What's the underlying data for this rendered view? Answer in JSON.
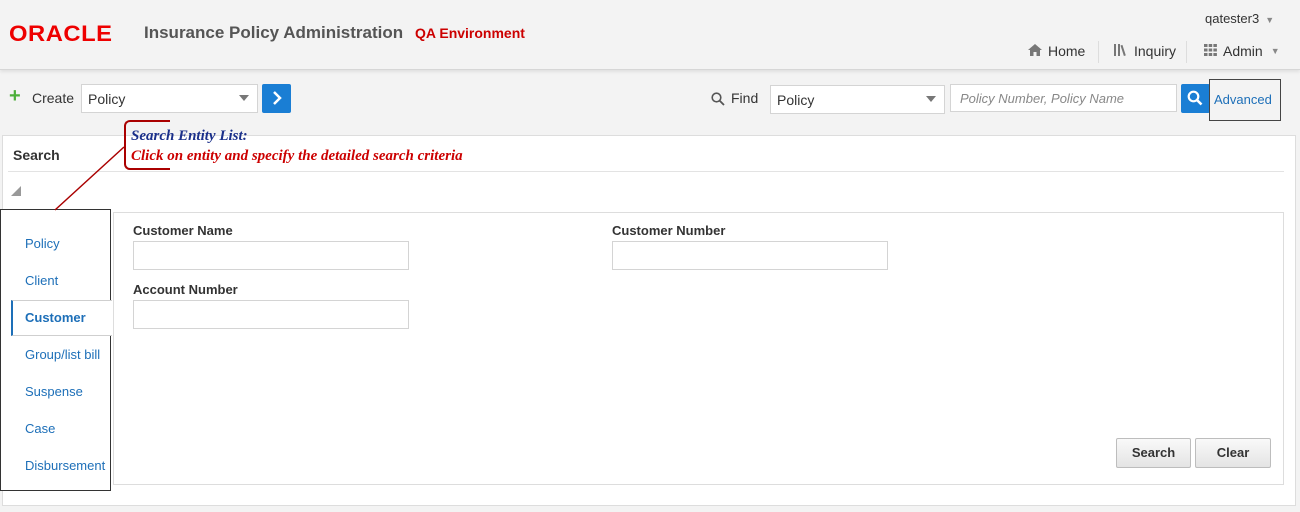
{
  "header": {
    "logo_text": "ORACLE",
    "app_title": "Insurance Policy Administration",
    "environment": "QA Environment",
    "user": "qatester3",
    "nav": [
      {
        "label": "Home",
        "icon": "home-icon"
      },
      {
        "label": "Inquiry",
        "icon": "library-icon"
      },
      {
        "label": "Admin",
        "icon": "grid-icon"
      }
    ]
  },
  "toolbar": {
    "create_label": "Create",
    "create_select": "Policy",
    "find_label": "Find",
    "find_select": "Policy",
    "find_placeholder": "Policy Number, Policy Name",
    "advanced_label": "Advanced"
  },
  "search": {
    "title": "Search",
    "entities": [
      "Policy",
      "Client",
      "Customer",
      "Group/list bill",
      "Suspense",
      "Case",
      "Disbursement"
    ],
    "active_entity": "Customer",
    "fields": {
      "customer_name_label": "Customer Name",
      "customer_number_label": "Customer Number",
      "account_number_label": "Account Number"
    },
    "search_button": "Search",
    "clear_button": "Clear"
  },
  "callout": {
    "title": "Search Entity List:",
    "text": "Click on entity and specify the detailed search criteria",
    "color_title": "#1a2f8a",
    "color_text": "#cc0000"
  },
  "colors": {
    "brand_red": "#ee0000",
    "link_blue": "#1d6fb8",
    "button_blue": "#1a7ed4"
  }
}
